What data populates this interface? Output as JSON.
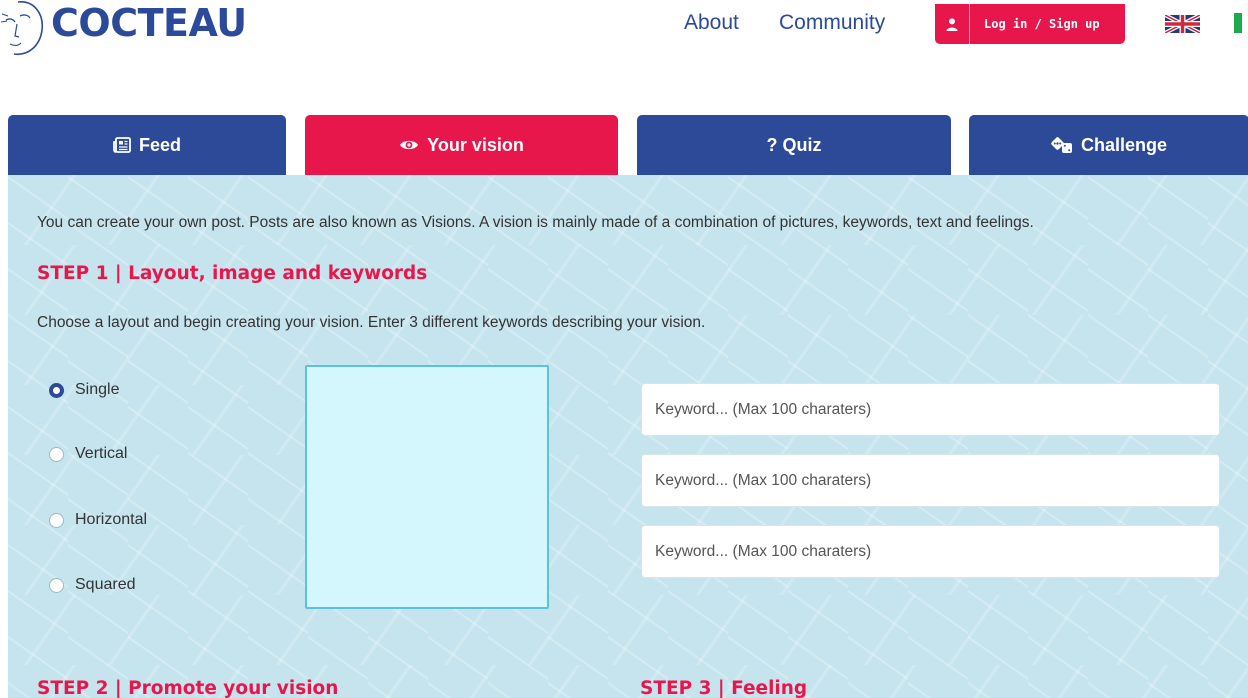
{
  "header": {
    "logo_text": "COCTEAU",
    "nav": [
      {
        "label": "About"
      },
      {
        "label": "Community"
      }
    ],
    "login_label": "Log in / Sign up"
  },
  "tabs": [
    {
      "label": "Feed",
      "icon": "newspaper-icon"
    },
    {
      "label": "Your vision",
      "icon": "eye-icon",
      "active": true
    },
    {
      "label": "? Quiz",
      "icon": "question-icon"
    },
    {
      "label": "Challenge",
      "icon": "dice-icon"
    }
  ],
  "content": {
    "intro": "You can create your own post. Posts are also known as Visions. A vision is mainly made of a combination of pictures, keywords, text and feelings.",
    "step1": {
      "title": "STEP 1 | Layout, image and keywords",
      "description": "Choose a layout and begin creating your vision. Enter 3 different keywords describing your vision.",
      "layouts": [
        {
          "label": "Single",
          "checked": true
        },
        {
          "label": "Vertical",
          "checked": false
        },
        {
          "label": "Horizontal",
          "checked": false
        },
        {
          "label": "Squared",
          "checked": false
        }
      ],
      "keyword_placeholder": "Keyword... (Max 100 charaters)"
    },
    "step2": {
      "title": "STEP 2 | Promote your vision"
    },
    "step3": {
      "title": "STEP 3 | Feeling"
    }
  },
  "colors": {
    "brand_blue": "#2d4a98",
    "accent_red": "#e8174b",
    "content_bg": "#c5e4ee",
    "image_box": "#d3f7fc"
  }
}
